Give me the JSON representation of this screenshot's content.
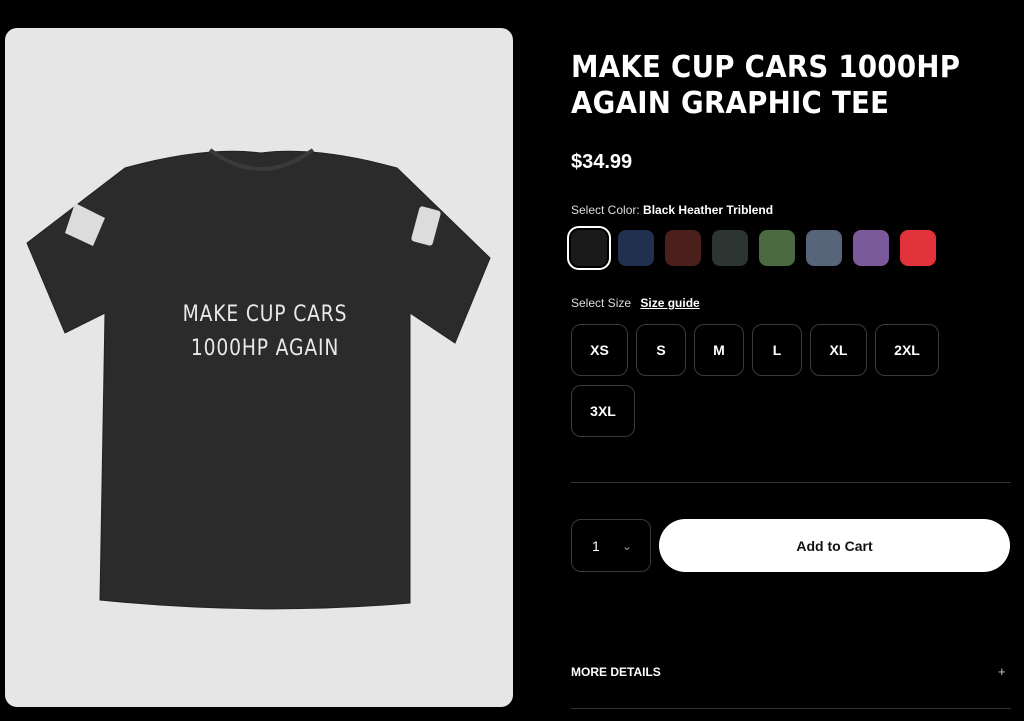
{
  "product_image": {
    "shirt_text_line1": "MAKE CUP CARS",
    "shirt_text_line2": "1000HP AGAIN",
    "shirt_color": "#2a2a2a",
    "background": "#e6e6e6"
  },
  "product": {
    "title": "MAKE CUP CARS 1000HP AGAIN GRAPHIC TEE",
    "price": "$34.99"
  },
  "color": {
    "label": "Select Color:",
    "selected": "Black Heather Triblend",
    "swatches": [
      "#1a1a1a",
      "#22304f",
      "#4a1f1c",
      "#2c3531",
      "#4c6a42",
      "#56657a",
      "#7a5a9a",
      "#e0333a"
    ]
  },
  "size": {
    "label": "Select Size",
    "guide_label": "Size guide",
    "options": [
      "XS",
      "S",
      "M",
      "L",
      "XL",
      "2XL",
      "3XL"
    ]
  },
  "cart": {
    "quantity": "1",
    "add_label": "Add to Cart"
  },
  "details": {
    "more_label": "MORE DETAILS",
    "toggle": "+"
  }
}
